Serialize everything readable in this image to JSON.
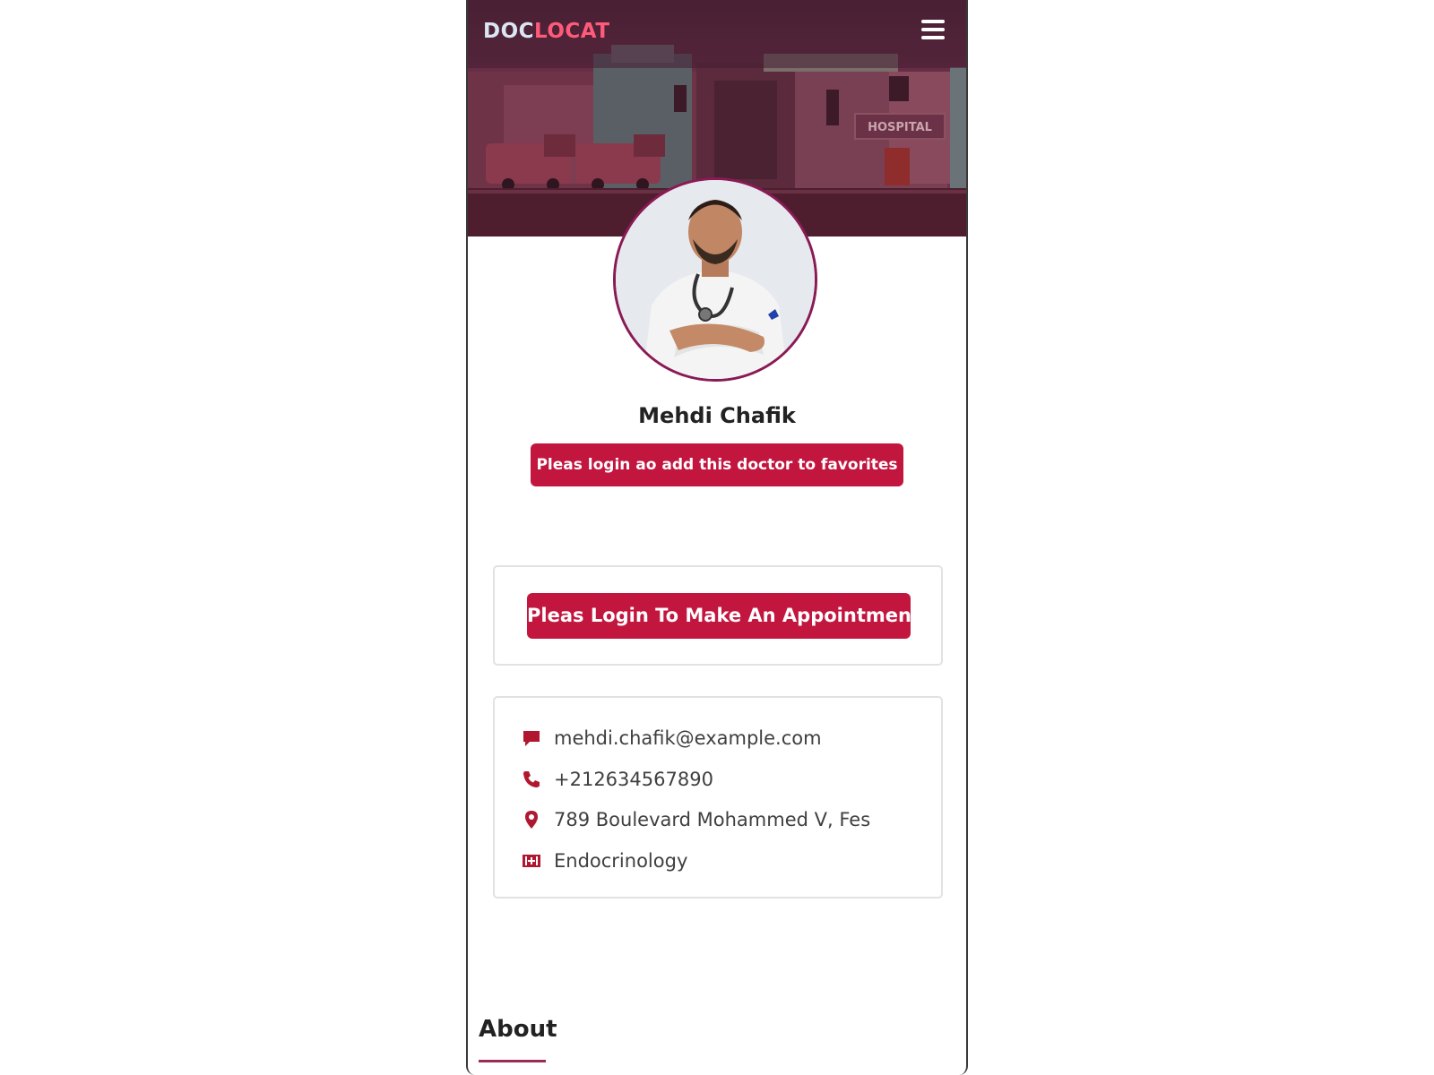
{
  "brand": {
    "part1": "DOC",
    "part2": "LOCAT"
  },
  "hero": {
    "sign_text": "HOSPITAL"
  },
  "doctor": {
    "name": "Mehdi Chafik",
    "favorites_button": "Pleas login ao add this doctor to favorites",
    "appointment_button": "Pleas Login To Make An Appointment"
  },
  "contact": {
    "email": "mehdi.chafik@example.com",
    "phone": "+212634567890",
    "address": "789 Boulevard Mohammed V, Fes",
    "specialty": "Endocrinology"
  },
  "icons": {
    "email": "message-icon",
    "phone": "phone-icon",
    "address": "location-pin-icon",
    "specialty": "medical-kit-icon",
    "menu": "hamburger-menu-icon"
  },
  "section": {
    "about_title": "About"
  },
  "colors": {
    "accent": "#c2163f",
    "brand_secondary": "#ff5a7a",
    "header": "#4e2439",
    "avatar_border": "#8a1a55"
  }
}
